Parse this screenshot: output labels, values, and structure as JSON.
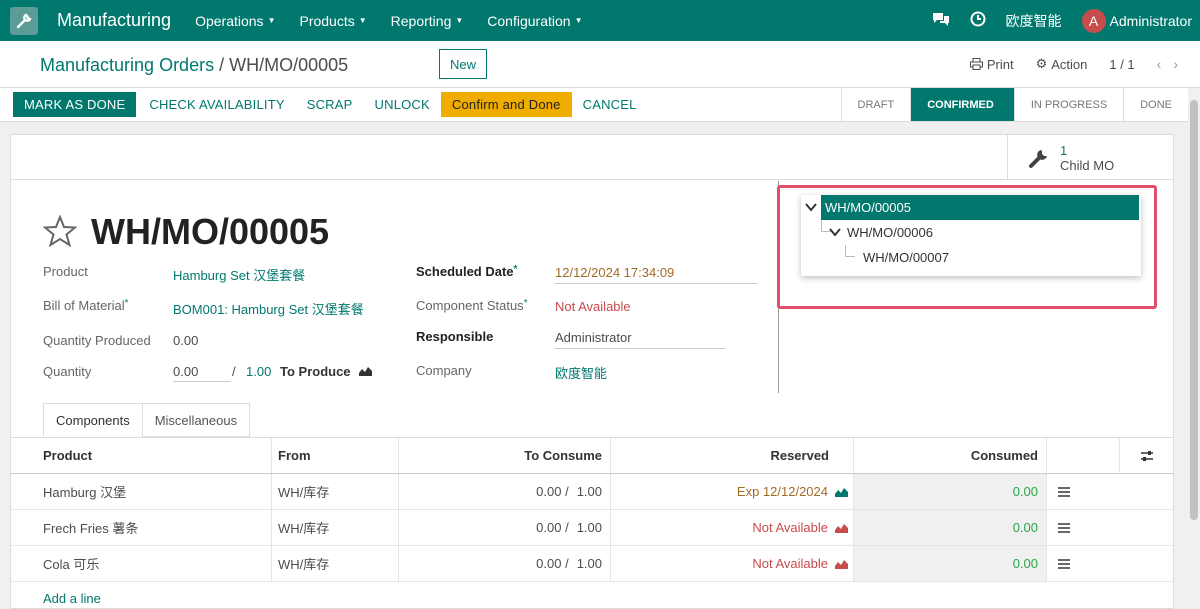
{
  "navbar": {
    "app_name": "Manufacturing",
    "menus": [
      "Operations",
      "Products",
      "Reporting",
      "Configuration"
    ],
    "company": "欧度智能",
    "user_initial": "A",
    "user_name": "Administrator",
    "brand_color": "#00786e"
  },
  "control": {
    "breadcrumb_parent": "Manufacturing Orders",
    "breadcrumb_sep": "/",
    "breadcrumb_current": "WH/MO/00005",
    "new_label": "New",
    "print_label": "Print",
    "action_label": "Action",
    "pager": "1 / 1"
  },
  "status_actions": {
    "mark_done": "MARK AS DONE",
    "check_availability": "CHECK AVAILABILITY",
    "scrap": "SCRAP",
    "unlock": "UNLOCK",
    "confirm_done": "Confirm and Done",
    "cancel": "CANCEL"
  },
  "stages": [
    "DRAFT",
    "CONFIRMED",
    "IN PROGRESS",
    "DONE"
  ],
  "active_stage": "CONFIRMED",
  "child_mo": {
    "count": "1",
    "label": "Child MO"
  },
  "record": {
    "title": "WH/MO/00005",
    "labels": {
      "product": "Product",
      "bom": "Bill of Material",
      "qty_produced": "Quantity Produced",
      "quantity": "Quantity",
      "scheduled": "Scheduled Date",
      "component_status": "Component Status",
      "responsible": "Responsible",
      "company": "Company"
    },
    "product": "Hamburg Set 汉堡套餐",
    "bom": "BOM001: Hamburg Set 汉堡套餐",
    "qty_produced": "0.00",
    "quantity": "0.00",
    "qty_sep": "/",
    "qty_total": "1.00",
    "to_produce": "To Produce",
    "scheduled": "12/12/2024 17:34:09",
    "component_status": "Not Available",
    "responsible": "Administrator",
    "company": "欧度智能"
  },
  "tree": [
    {
      "label": "WH/MO/00005",
      "level": 0
    },
    {
      "label": "WH/MO/00006",
      "level": 1
    },
    {
      "label": "WH/MO/00007",
      "level": 2
    }
  ],
  "tabs": [
    "Components",
    "Miscellaneous"
  ],
  "table": {
    "headers": [
      "Product",
      "From",
      "To Consume",
      "Reserved",
      "Consumed"
    ],
    "rows": [
      {
        "product": "Hamburg 汉堡",
        "from": "WH/库存",
        "to_consume": "0.00 /",
        "total": "1.00",
        "reserved": "Exp 12/12/2024",
        "reserved_state": "ok",
        "consumed": "0.00"
      },
      {
        "product": "Frech Fries 薯条",
        "from": "WH/库存",
        "to_consume": "0.00 /",
        "total": "1.00",
        "reserved": "Not Available",
        "reserved_state": "na",
        "consumed": "0.00"
      },
      {
        "product": "Cola 可乐",
        "from": "WH/库存",
        "to_consume": "0.00 /",
        "total": "1.00",
        "reserved": "Not Available",
        "reserved_state": "na",
        "consumed": "0.00"
      }
    ],
    "add_line": "Add a line"
  }
}
